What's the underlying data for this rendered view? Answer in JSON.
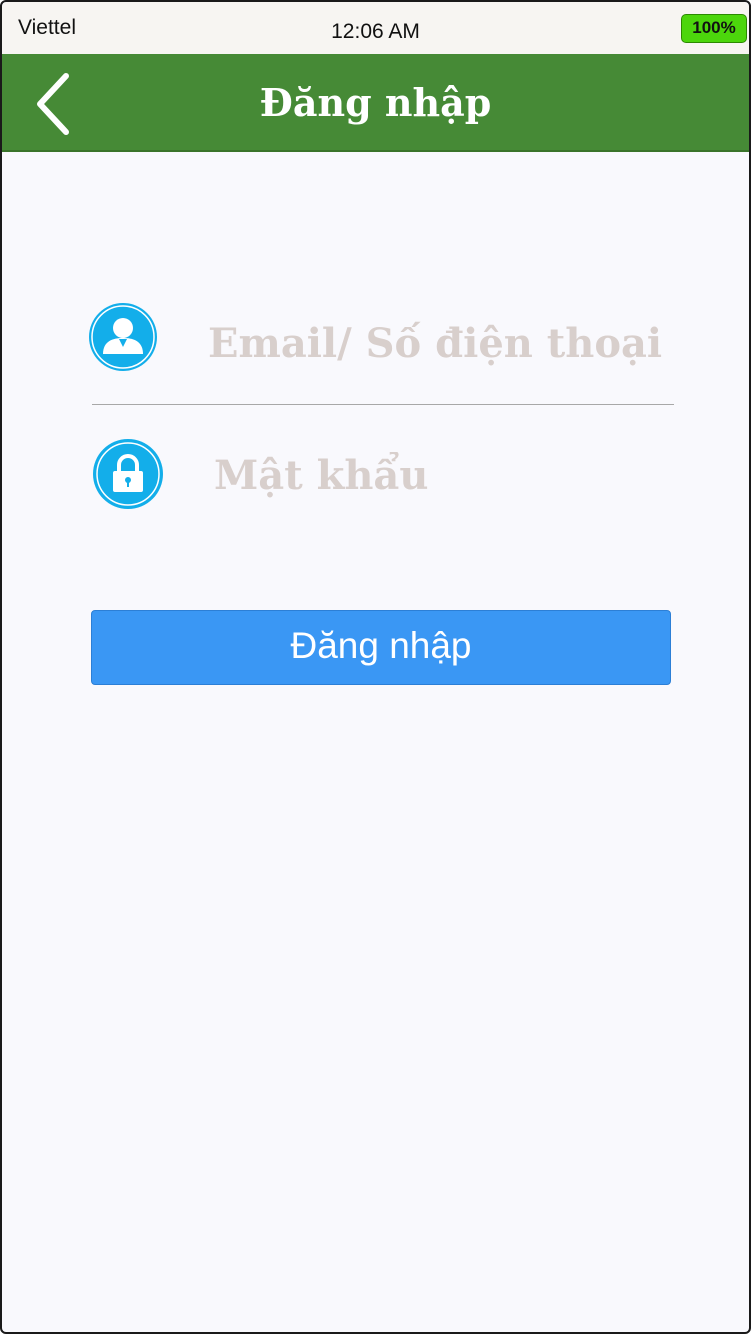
{
  "status_bar": {
    "carrier": "Viettel",
    "time": "12:06 AM",
    "battery": "100%"
  },
  "nav": {
    "title": "Đăng nhập",
    "back_icon": "chevron-left-icon"
  },
  "form": {
    "email_placeholder": "Email/ Số điện thoại",
    "email_value": "",
    "password_placeholder": "Mật khẩu",
    "password_value": "",
    "user_icon": "user-icon",
    "lock_icon": "lock-icon",
    "submit_label": "Đăng nhập"
  },
  "colors": {
    "nav_background": "#468a36",
    "button_background": "#3a97f4",
    "icon_blue": "#13aeea",
    "battery_green": "#4cd60c"
  }
}
